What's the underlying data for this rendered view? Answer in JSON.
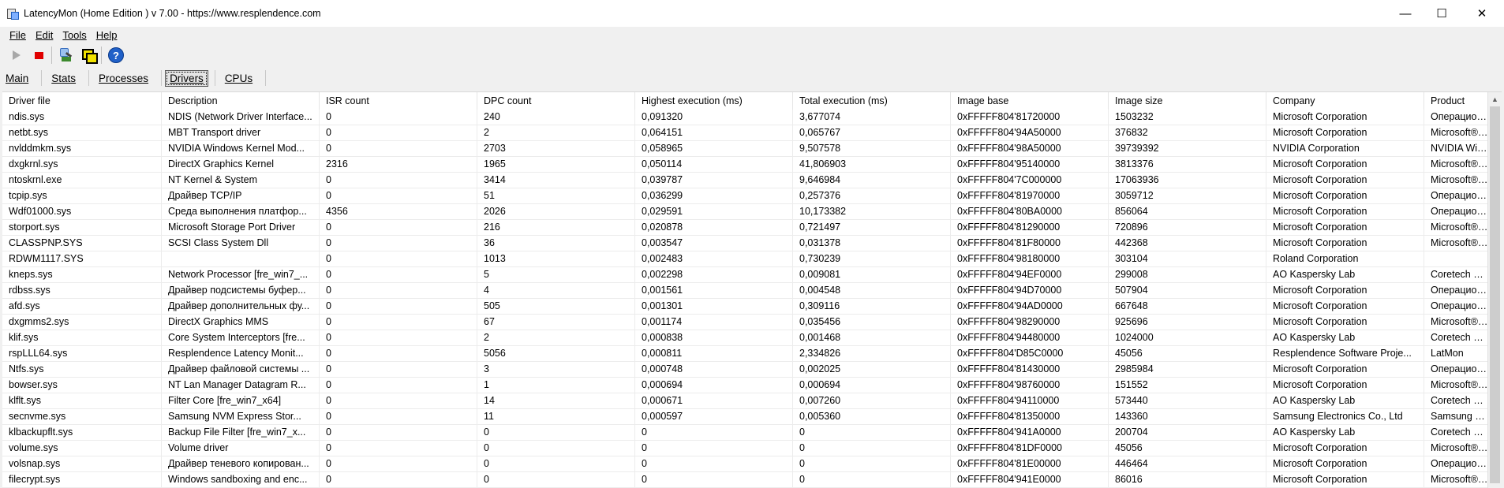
{
  "window": {
    "title": "LatencyMon  (Home Edition )  v 7.00 - https://www.resplendence.com",
    "minimize": "—",
    "maximize": "☐",
    "close": "✕"
  },
  "menu": [
    "File",
    "Edit",
    "Tools",
    "Help"
  ],
  "toolbar": {
    "play_icon": "play-icon",
    "stop_icon": "stop-icon",
    "help_label": "?"
  },
  "tabs": [
    "Main",
    "Stats",
    "Processes",
    "Drivers",
    "CPUs"
  ],
  "active_tab": "Drivers",
  "columns": [
    "Driver file",
    "Description",
    "ISR count",
    "DPC count",
    "Highest execution (ms)",
    "Total execution (ms)",
    "Image base",
    "Image size",
    "Company",
    "Product"
  ],
  "rows": [
    [
      "ndis.sys",
      "NDIS (Network Driver Interface...",
      "0",
      "240",
      "0,091320",
      "3,677074",
      "0xFFFFF804'81720000",
      "1503232",
      "Microsoft Corporation",
      "Операционная"
    ],
    [
      "netbt.sys",
      "MBT Transport driver",
      "0",
      "2",
      "0,064151",
      "0,065767",
      "0xFFFFF804'94A50000",
      "376832",
      "Microsoft Corporation",
      "Microsoft® Windows"
    ],
    [
      "nvlddmkm.sys",
      "NVIDIA Windows Kernel Mod...",
      "0",
      "2703",
      "0,058965",
      "9,507578",
      "0xFFFFF804'98A50000",
      "39739392",
      "NVIDIA Corporation",
      "NVIDIA Windows"
    ],
    [
      "dxgkrnl.sys",
      "DirectX Graphics Kernel",
      "2316",
      "1965",
      "0,050114",
      "41,806903",
      "0xFFFFF804'95140000",
      "3813376",
      "Microsoft Corporation",
      "Microsoft® Windows"
    ],
    [
      "ntoskrnl.exe",
      "NT Kernel & System",
      "0",
      "3414",
      "0,039787",
      "9,646984",
      "0xFFFFF804'7C000000",
      "17063936",
      "Microsoft Corporation",
      "Microsoft® Windows"
    ],
    [
      "tcpip.sys",
      "Драйвер TCP/IP",
      "0",
      "51",
      "0,036299",
      "0,257376",
      "0xFFFFF804'81970000",
      "3059712",
      "Microsoft Corporation",
      "Операционная"
    ],
    [
      "Wdf01000.sys",
      "Среда выполнения платфор...",
      "4356",
      "2026",
      "0,029591",
      "10,173382",
      "0xFFFFF804'80BA0000",
      "856064",
      "Microsoft Corporation",
      "Операционная"
    ],
    [
      "storport.sys",
      "Microsoft Storage Port Driver",
      "0",
      "216",
      "0,020878",
      "0,721497",
      "0xFFFFF804'81290000",
      "720896",
      "Microsoft Corporation",
      "Microsoft® Windows"
    ],
    [
      "CLASSPNP.SYS",
      "SCSI Class System Dll",
      "0",
      "36",
      "0,003547",
      "0,031378",
      "0xFFFFF804'81F80000",
      "442368",
      "Microsoft Corporation",
      "Microsoft® Windows"
    ],
    [
      "RDWM1117.SYS",
      "",
      "0",
      "1013",
      "0,002483",
      "0,730239",
      "0xFFFFF804'98180000",
      "303104",
      "Roland Corporation",
      ""
    ],
    [
      "kneps.sys",
      "Network Processor [fre_win7_...",
      "0",
      "5",
      "0,002298",
      "0,009081",
      "0xFFFFF804'94EF0000",
      "299008",
      "AO Kaspersky Lab",
      "Coretech Delivery"
    ],
    [
      "rdbss.sys",
      "Драйвер подсистемы буфер...",
      "0",
      "4",
      "0,001561",
      "0,004548",
      "0xFFFFF804'94D70000",
      "507904",
      "Microsoft Corporation",
      "Операционная"
    ],
    [
      "afd.sys",
      "Драйвер дополнительных фу...",
      "0",
      "505",
      "0,001301",
      "0,309116",
      "0xFFFFF804'94AD0000",
      "667648",
      "Microsoft Corporation",
      "Операционная"
    ],
    [
      "dxgmms2.sys",
      "DirectX Graphics MMS",
      "0",
      "67",
      "0,001174",
      "0,035456",
      "0xFFFFF804'98290000",
      "925696",
      "Microsoft Corporation",
      "Microsoft® Windows"
    ],
    [
      "klif.sys",
      "Core System Interceptors [fre...",
      "0",
      "2",
      "0,000838",
      "0,001468",
      "0xFFFFF804'94480000",
      "1024000",
      "AO Kaspersky Lab",
      "Coretech Delivery"
    ],
    [
      "rspLLL64.sys",
      "Resplendence Latency Monit...",
      "0",
      "5056",
      "0,000811",
      "2,334826",
      "0xFFFFF804'D85C0000",
      "45056",
      "Resplendence Software Proje...",
      "LatMon"
    ],
    [
      "Ntfs.sys",
      "Драйвер файловой системы ...",
      "0",
      "3",
      "0,000748",
      "0,002025",
      "0xFFFFF804'81430000",
      "2985984",
      "Microsoft Corporation",
      "Операционная"
    ],
    [
      "bowser.sys",
      "NT Lan Manager Datagram R...",
      "0",
      "1",
      "0,000694",
      "0,000694",
      "0xFFFFF804'98760000",
      "151552",
      "Microsoft Corporation",
      "Microsoft® Windows"
    ],
    [
      "klflt.sys",
      "Filter Core [fre_win7_x64]",
      "0",
      "14",
      "0,000671",
      "0,007260",
      "0xFFFFF804'94110000",
      "573440",
      "AO Kaspersky Lab",
      "Coretech Delivery"
    ],
    [
      "secnvme.sys",
      "Samsung NVM Express Stor...",
      "0",
      "11",
      "0,000597",
      "0,005360",
      "0xFFFFF804'81350000",
      "143360",
      "Samsung Electronics Co., Ltd",
      "Samsung NVM"
    ],
    [
      "klbackupflt.sys",
      "Backup File Filter [fre_win7_x...",
      "0",
      "0",
      "0",
      "0",
      "0xFFFFF804'941A0000",
      "200704",
      "AO Kaspersky Lab",
      "Coretech Delivery"
    ],
    [
      "volume.sys",
      "Volume driver",
      "0",
      "0",
      "0",
      "0",
      "0xFFFFF804'81DF0000",
      "45056",
      "Microsoft Corporation",
      "Microsoft® Windows"
    ],
    [
      "volsnap.sys",
      "Драйвер теневого копирован...",
      "0",
      "0",
      "0",
      "0",
      "0xFFFFF804'81E00000",
      "446464",
      "Microsoft Corporation",
      "Операционная"
    ],
    [
      "filecrypt.sys",
      "Windows sandboxing and enc...",
      "0",
      "0",
      "0",
      "0",
      "0xFFFFF804'941E0000",
      "86016",
      "Microsoft Corporation",
      "Microsoft® Windows"
    ]
  ]
}
